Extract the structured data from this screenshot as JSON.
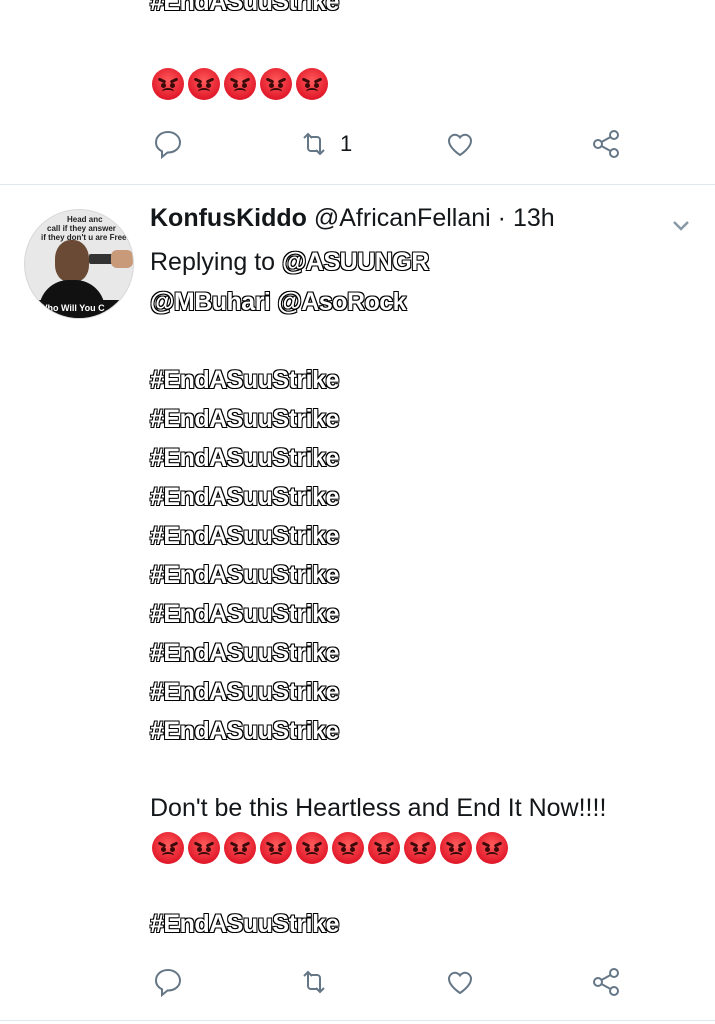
{
  "tweet_top": {
    "partial_hashtag": "#EndASuuStrike",
    "angry_emoji_count": 5,
    "reply_icon": "reply-icon",
    "retweet_icon": "retweet-icon",
    "retweet_count": "1",
    "like_icon": "heart-icon",
    "share_icon": "share-icon"
  },
  "tweet": {
    "display_name": "KonfusKiddo",
    "handle": "@AfricanFellani",
    "separator": "·",
    "time": "13h",
    "replying_to_label": "Replying to",
    "mentions": [
      "@ASUUNGR",
      "@MBuhari",
      "@AsoRock"
    ],
    "hashtags": [
      "#EndASuuStrike",
      "#EndASuuStrike",
      "#EndASuuStrike",
      "#EndASuuStrike",
      "#EndASuuStrike",
      "#EndASuuStrike",
      "#EndASuuStrike",
      "#EndASuuStrike",
      "#EndASuuStrike",
      "#EndASuuStrike"
    ],
    "message": "Don't be this Heartless and End It Now!!!!",
    "angry_emoji_count": 10,
    "final_hashtag": "#EndASuuStrike",
    "avatar": {
      "text_line1": "Head anc",
      "text_line2": "call if they answer",
      "text_line3": "if they don't u are Free.",
      "band_text": "Who Will You C"
    }
  },
  "colors": {
    "icon_gray": "#657786",
    "divider": "#e1e8ed",
    "angry_red": "#e21b2c"
  }
}
